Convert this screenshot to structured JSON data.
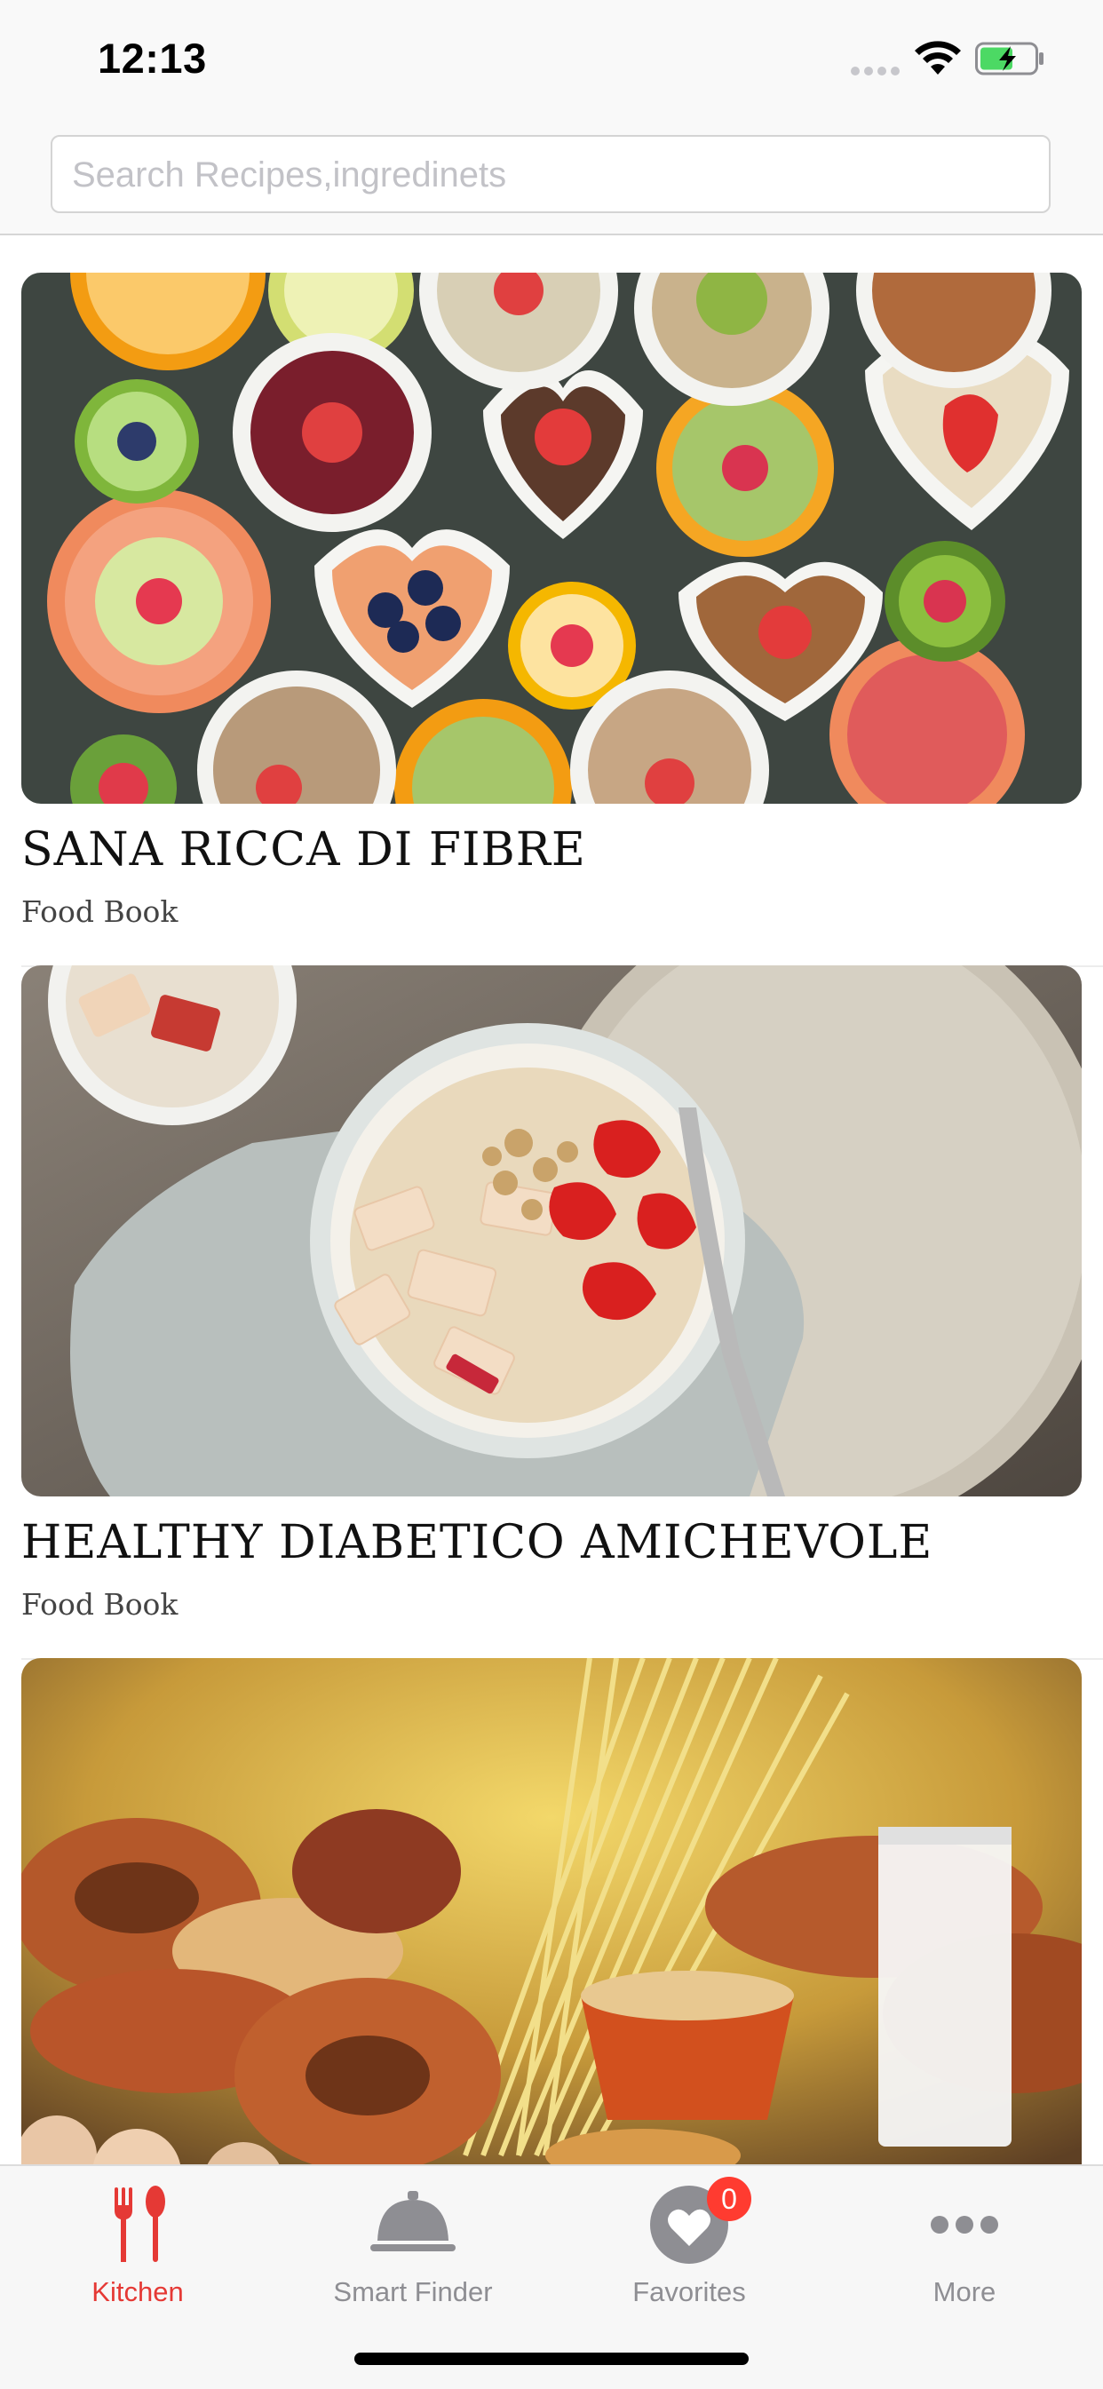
{
  "status_bar": {
    "time": "12:13"
  },
  "search": {
    "placeholder": "Search Recipes,ingredinets"
  },
  "recipes": [
    {
      "title": "SANA RICCA DI FIBRE",
      "subtitle": "Food Book"
    },
    {
      "title": "HEALTHY DIABETICO AMICHEVOLE",
      "subtitle": "Food Book"
    },
    {
      "title": "",
      "subtitle": ""
    }
  ],
  "tab_bar": {
    "items": [
      {
        "label": "Kitchen",
        "icon": "fork-spoon-icon",
        "active": true
      },
      {
        "label": "Smart Finder",
        "icon": "cloche-icon",
        "active": false
      },
      {
        "label": "Favorites",
        "icon": "heart-icon",
        "active": false,
        "badge": "0"
      },
      {
        "label": "More",
        "icon": "more-dots-icon",
        "active": false
      }
    ]
  },
  "colors": {
    "accent": "#e53935",
    "inactive": "#8e8e93",
    "badge": "#ff3b30"
  }
}
